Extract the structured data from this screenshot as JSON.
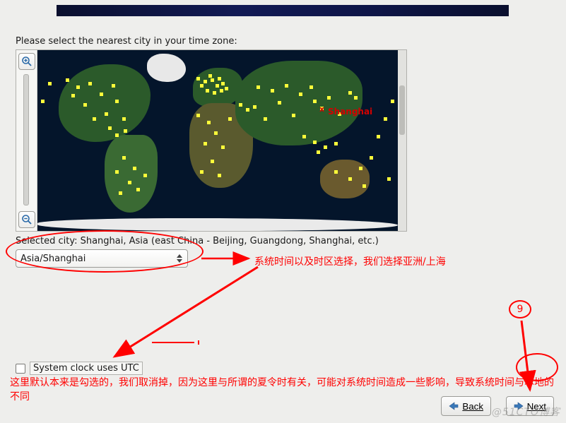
{
  "header": {
    "banner": ""
  },
  "prompt": "Please select the nearest city in your time zone:",
  "map": {
    "selected_marker_label": "Shanghai",
    "selected_marker_x": "x"
  },
  "selected_city_label": "Selected city: Shanghai, Asia (east China - Beijing, Guangdong, Shanghai, etc.)",
  "dropdown": {
    "value": "Asia/Shanghai"
  },
  "utc": {
    "checked": false,
    "label": "System clock uses UTC"
  },
  "annotations": {
    "dropdown_note": "系统时间以及时区选择，我们选择亚洲/上海",
    "utc_note": "这里默认本来是勾选的，我们取消掉，因为这里与所谓的夏令时有关，可能对系统时间造成一些影响，导致系统时间与本地的不同",
    "step_number": "9"
  },
  "buttons": {
    "back_icon": "◀",
    "back_label": "Back",
    "next_icon": "▶",
    "next_label": "Next"
  },
  "watermark": "@51CTO博客"
}
